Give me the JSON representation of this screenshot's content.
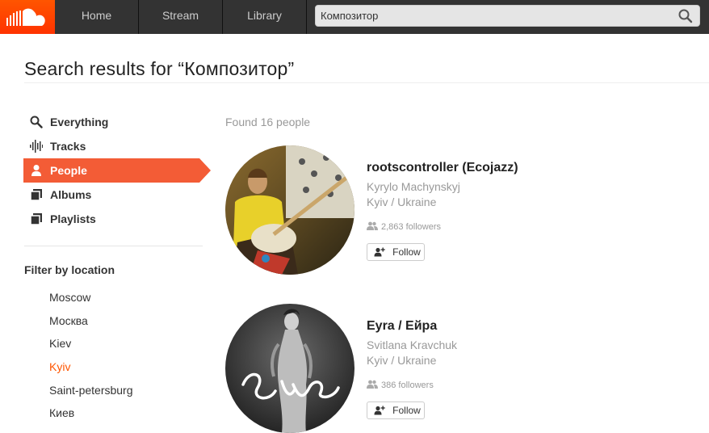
{
  "header": {
    "nav": [
      {
        "label": "Home"
      },
      {
        "label": "Stream"
      },
      {
        "label": "Library"
      }
    ],
    "search": {
      "value": "Композитор"
    }
  },
  "page": {
    "title": "Search results for “Композитор”"
  },
  "sidebar": {
    "items": [
      {
        "label": "Everything",
        "icon": "search-icon"
      },
      {
        "label": "Tracks",
        "icon": "waveform-icon"
      },
      {
        "label": "People",
        "icon": "person-icon",
        "active": true
      },
      {
        "label": "Albums",
        "icon": "albums-icon"
      },
      {
        "label": "Playlists",
        "icon": "playlists-icon"
      }
    ],
    "filter_heading": "Filter by location",
    "locations": [
      {
        "label": "Moscow"
      },
      {
        "label": "Москва"
      },
      {
        "label": "Kiev"
      },
      {
        "label": "Kyiv",
        "selected": true
      },
      {
        "label": "Saint-petersburg"
      },
      {
        "label": "Киев"
      }
    ]
  },
  "results": {
    "found_text": "Found 16 people",
    "people": [
      {
        "username": "rootscontroller (Ecojazz)",
        "real_name": "Kyrylo Machynskyj",
        "location": "Kyiv / Ukraine",
        "followers": "2,863 followers",
        "follow_label": "Follow"
      },
      {
        "username": "Eyra / Ейра",
        "real_name": "Svitlana Kravchuk",
        "location": "Kyiv / Ukraine",
        "followers": "386 followers",
        "follow_label": "Follow"
      }
    ]
  },
  "colors": {
    "accent": "#f35c36",
    "brand": "#ff5500",
    "topbar": "#333333",
    "muted_text": "#999999"
  }
}
